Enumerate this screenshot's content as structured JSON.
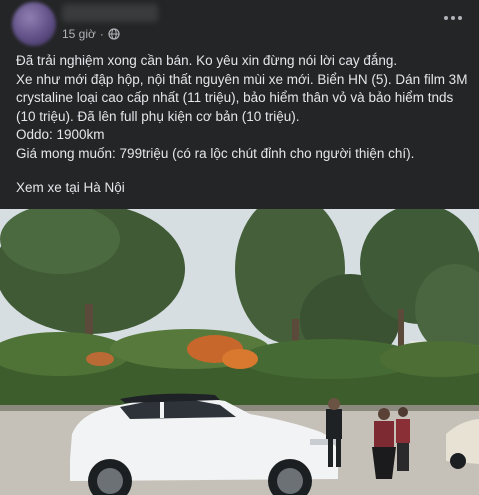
{
  "post": {
    "timestamp": "15 giờ",
    "separator": "·",
    "privacy_icon": "globe-icon",
    "more_icon": "more-options-icon",
    "body_lines": [
      "Đã trải nghiệm xong cần bán. Ko yêu xin đừng nói lời cay đắng.",
      "Xe như mới đập hộp, nội thất nguyên mùi xe mới. Biển HN (5). Dán film 3M crystaline loại cao cấp nhất (11 triệu), bảo hiểm thân vỏ và bảo hiểm tnds (10 triệu). Đã lên full phụ kiện cơ bản (10 triệu).",
      "Oddo: 1900km",
      "Giá mong muốn: 799triệu (có ra lộc chút đỉnh cho người thiện chí)."
    ],
    "location_text": "Xem xe tại Hà Nội"
  },
  "colors": {
    "background": "#242526",
    "text": "#e4e6eb",
    "secondary_text": "#b0b3b8",
    "car": "#f2f3f4"
  }
}
